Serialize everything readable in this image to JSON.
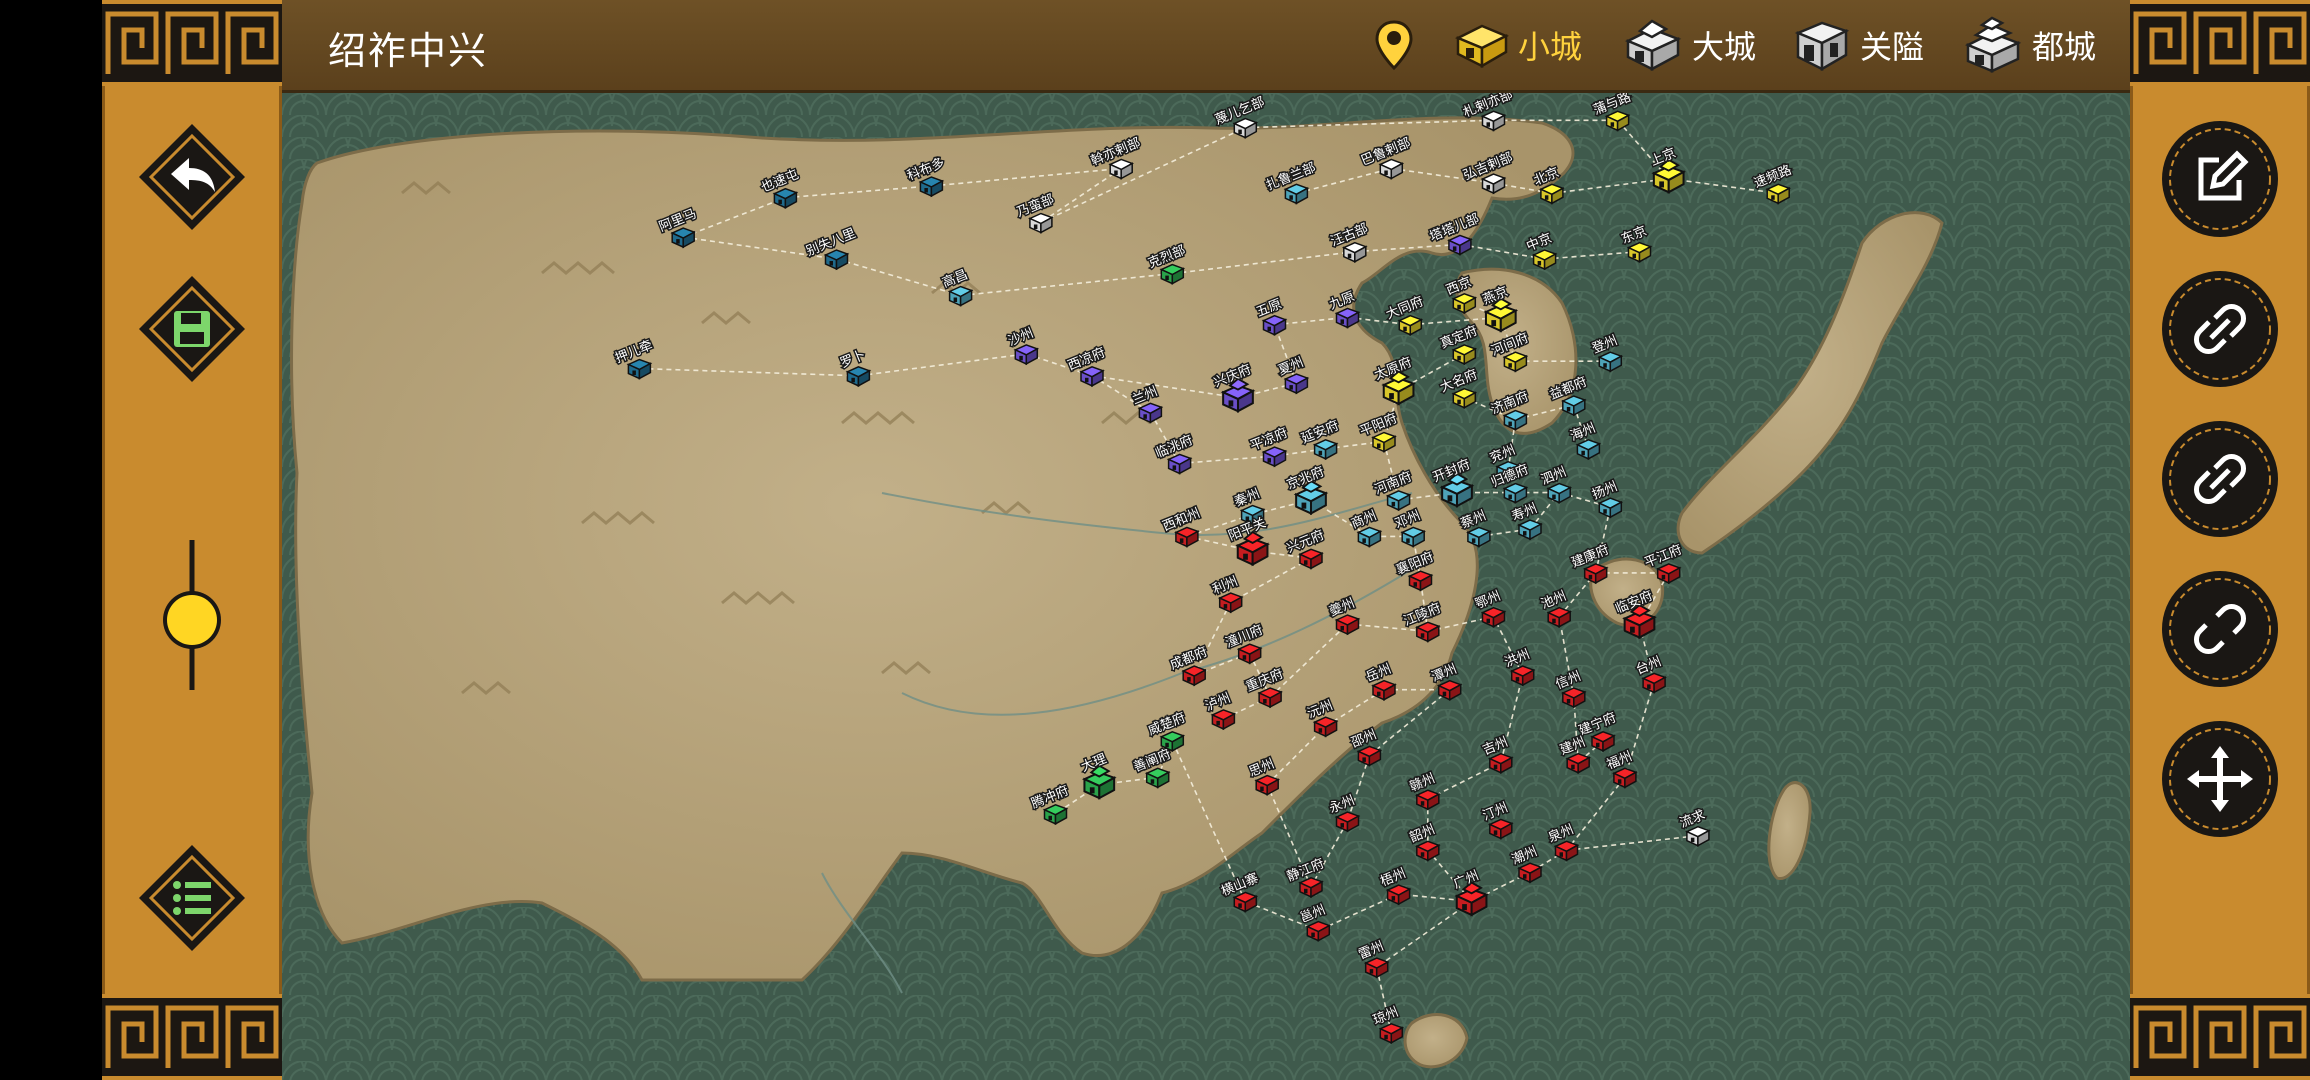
{
  "title": "绍祚中兴",
  "legend": {
    "small_city": "小城",
    "big_city": "大城",
    "pass": "关隘",
    "capital": "都城"
  },
  "slider": {
    "value": 0.4
  },
  "colors": {
    "panel": "#c98b2e",
    "topbar": "#614520",
    "sea": "#3f5a4c",
    "land": "#b9a67a",
    "song_red": "#c51d20",
    "jin_yellow": "#d8c62a",
    "xia_purple": "#6a4fc7",
    "mongol_blue": "#1f6a8c",
    "teal": "#4ea3b8",
    "dali_green": "#2aa34a",
    "neutral_gray": "#d8d8d8",
    "active_gold": "#ffd23d"
  },
  "cities": [
    {
      "name": "乃蛮部"
    },
    {
      "name": "蔑儿乞部"
    },
    {
      "name": "札剌亦部"
    },
    {
      "name": "蒲与路"
    },
    {
      "name": "也速屯"
    },
    {
      "name": "科布多"
    },
    {
      "name": "斡亦剌部"
    },
    {
      "name": "汪古部"
    },
    {
      "name": "扎鲁兰部"
    },
    {
      "name": "巴鲁剌部"
    },
    {
      "name": "弘吉剌部"
    },
    {
      "name": "上京"
    },
    {
      "name": "速频路"
    },
    {
      "name": "阿里马"
    },
    {
      "name": "北京"
    },
    {
      "name": "别失八里"
    },
    {
      "name": "高昌"
    },
    {
      "name": "克烈部"
    },
    {
      "name": "塔塔儿部"
    },
    {
      "name": "东京"
    },
    {
      "name": "中京"
    },
    {
      "name": "西京"
    },
    {
      "name": "燕京"
    },
    {
      "name": "大同府"
    },
    {
      "name": "沙州"
    },
    {
      "name": "西凉府"
    },
    {
      "name": "五原"
    },
    {
      "name": "九原"
    },
    {
      "name": "真定府"
    },
    {
      "name": "河间府"
    },
    {
      "name": "登州"
    },
    {
      "name": "押儿牵"
    },
    {
      "name": "罗卜"
    },
    {
      "name": "兰州"
    },
    {
      "name": "兴庆府"
    },
    {
      "name": "夏州"
    },
    {
      "name": "太原府"
    },
    {
      "name": "大名府"
    },
    {
      "name": "济南府"
    },
    {
      "name": "益都府"
    },
    {
      "name": "临洮府"
    },
    {
      "name": "平凉府"
    },
    {
      "name": "延安府"
    },
    {
      "name": "平阳府"
    },
    {
      "name": "开封府"
    },
    {
      "name": "兖州"
    },
    {
      "name": "海州"
    },
    {
      "name": "西和州"
    },
    {
      "name": "秦州"
    },
    {
      "name": "京兆府"
    },
    {
      "name": "河南府"
    },
    {
      "name": "归德府"
    },
    {
      "name": "泗州"
    },
    {
      "name": "扬州"
    },
    {
      "name": "阳平关"
    },
    {
      "name": "兴元府"
    },
    {
      "name": "商州"
    },
    {
      "name": "邓州"
    },
    {
      "name": "蔡州"
    },
    {
      "name": "寿州"
    },
    {
      "name": "利州"
    },
    {
      "name": "襄阳府"
    },
    {
      "name": "建康府"
    },
    {
      "name": "平江府"
    },
    {
      "name": "成都府"
    },
    {
      "name": "潼川府"
    },
    {
      "name": "夔州"
    },
    {
      "name": "江陵府"
    },
    {
      "name": "鄂州"
    },
    {
      "name": "池州"
    },
    {
      "name": "临安府"
    },
    {
      "name": "泸州"
    },
    {
      "name": "重庆府"
    },
    {
      "name": "岳州"
    },
    {
      "name": "洪州"
    },
    {
      "name": "信州"
    },
    {
      "name": "台州"
    },
    {
      "name": "沅州"
    },
    {
      "name": "潭州"
    },
    {
      "name": "建宁府"
    },
    {
      "name": "邵州"
    },
    {
      "name": "吉州"
    },
    {
      "name": "建州"
    },
    {
      "name": "福州"
    },
    {
      "name": "大理"
    },
    {
      "name": "善阐府"
    },
    {
      "name": "思州"
    },
    {
      "name": "永州"
    },
    {
      "name": "赣州"
    },
    {
      "name": "静江府"
    },
    {
      "name": "韶州"
    },
    {
      "name": "汀州"
    },
    {
      "name": "泉州"
    },
    {
      "name": "流求"
    },
    {
      "name": "腾冲府"
    },
    {
      "name": "威楚府"
    },
    {
      "name": "横山寨"
    },
    {
      "name": "邕州"
    },
    {
      "name": "梧州"
    },
    {
      "name": "广州"
    },
    {
      "name": "潮州"
    },
    {
      "name": "雷州"
    },
    {
      "name": "琼州"
    }
  ]
}
